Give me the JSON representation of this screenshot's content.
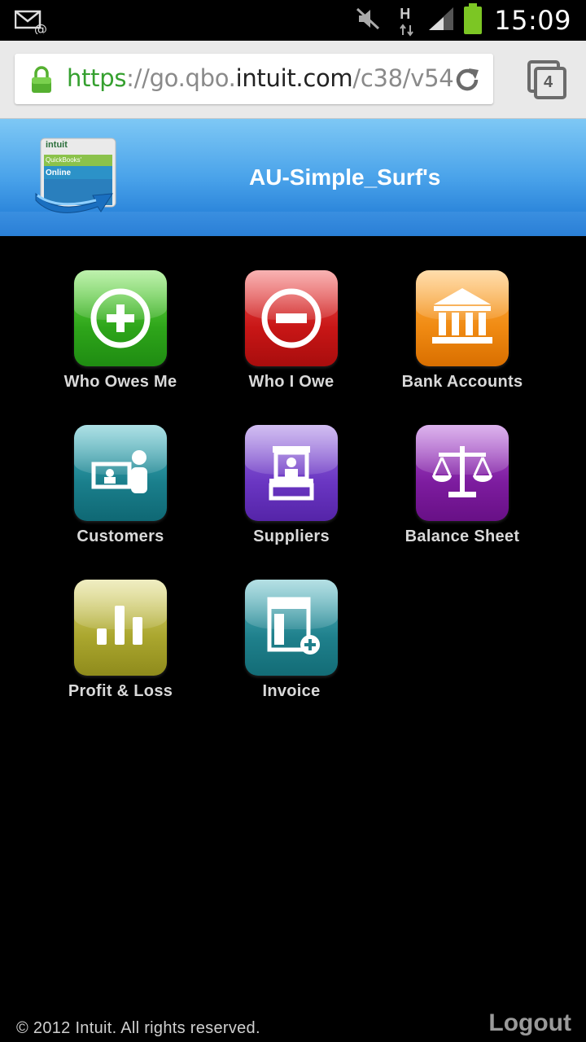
{
  "status_bar": {
    "time": "15:09",
    "network_type": "H",
    "icons": [
      "email-icon",
      "mute-icon",
      "network-type-icon",
      "signal-icon",
      "battery-icon"
    ]
  },
  "browser": {
    "url_scheme": "https",
    "url_sep": "://",
    "url_sub": "go.qbo.",
    "url_host": "intuit.com",
    "url_path": "/c38/v54",
    "tab_count": "4"
  },
  "header": {
    "company_name": "AU-Simple_Surf's",
    "logo_brand": "intuit",
    "logo_product": "QuickBooks'",
    "logo_edition": "Online"
  },
  "menu": {
    "items": [
      {
        "label": "Who Owes Me",
        "icon": "plus-circle-icon",
        "color": "#2ea51a"
      },
      {
        "label": "Who I Owe",
        "icon": "minus-circle-icon",
        "color": "#c81616"
      },
      {
        "label": "Bank Accounts",
        "icon": "bank-icon",
        "color": "#f08a12"
      },
      {
        "label": "Customers",
        "icon": "customer-icon",
        "color": "#1a7f8c"
      },
      {
        "label": "Suppliers",
        "icon": "supplier-icon",
        "color": "#6a36c2"
      },
      {
        "label": "Balance Sheet",
        "icon": "scales-icon",
        "color": "#7d1c9f"
      },
      {
        "label": "Profit & Loss",
        "icon": "bar-chart-icon",
        "color": "#aaa62e"
      },
      {
        "label": "Invoice",
        "icon": "invoice-add-icon",
        "color": "#1f808c"
      }
    ]
  },
  "footer": {
    "copyright": "© 2012 Intuit. All rights reserved.",
    "logout_label": "Logout"
  }
}
